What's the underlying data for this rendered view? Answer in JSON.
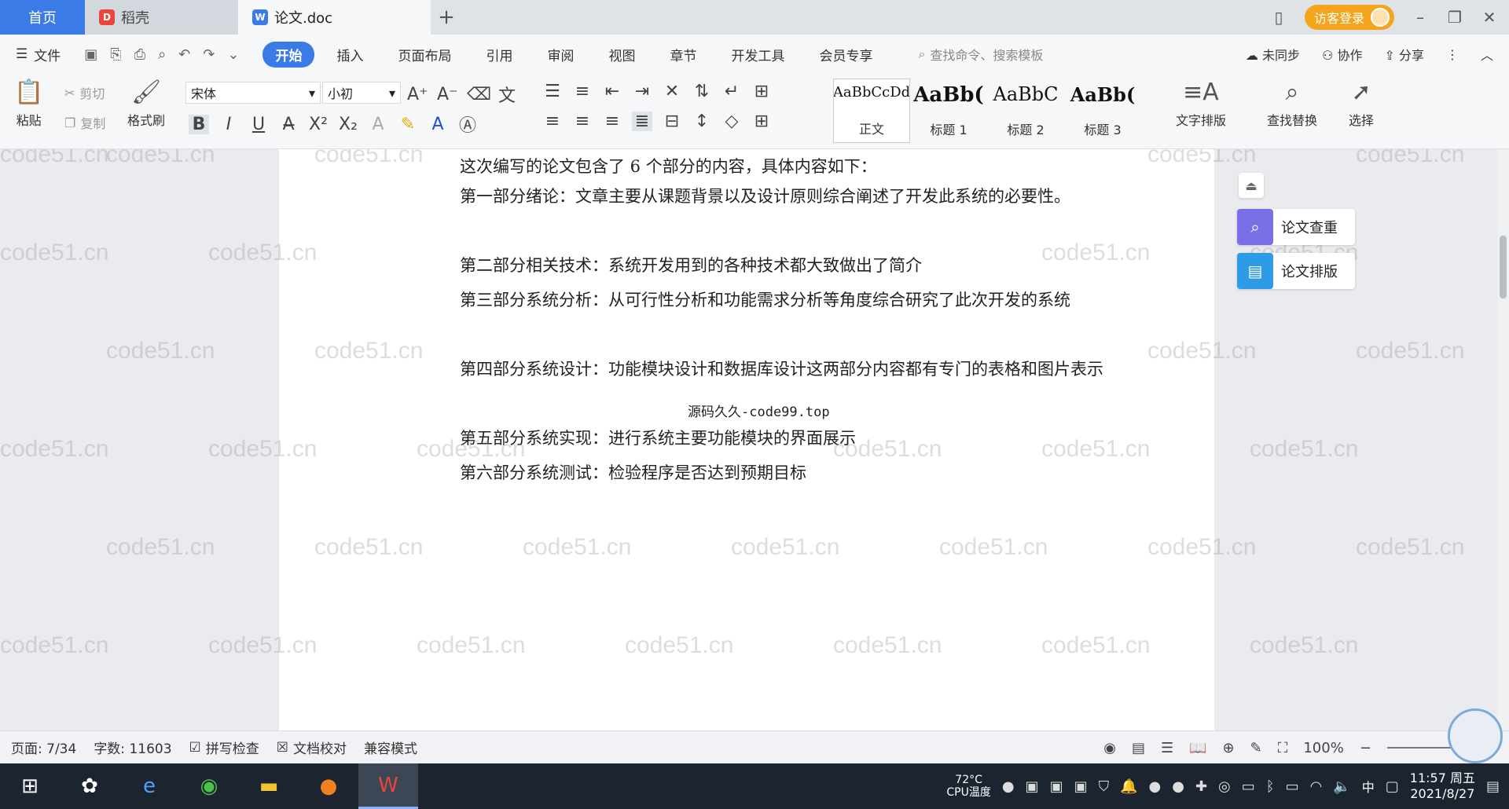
{
  "titlebar": {
    "tabs": [
      {
        "label": "首页",
        "icon": "home"
      },
      {
        "label": "稻壳",
        "icon": "docer-icon"
      },
      {
        "label": "论文.doc",
        "icon": "word-doc-icon"
      }
    ],
    "visitor_label": "访客登录"
  },
  "menubar": {
    "file_label": "文件",
    "tabs": [
      "开始",
      "插入",
      "页面布局",
      "引用",
      "审阅",
      "视图",
      "章节",
      "开发工具",
      "会员专享"
    ],
    "active_tab": "开始",
    "search_placeholder": "查找命令、搜索模板",
    "unsynced_label": "未同步",
    "collab_label": "协作",
    "share_label": "分享"
  },
  "ribbon": {
    "paste_label": "粘贴",
    "cut_label": "剪切",
    "copy_label": "复制",
    "format_painter_label": "格式刷",
    "font_name": "宋体",
    "font_size": "小初",
    "styles": [
      {
        "sample": "AaBbCcDd",
        "label": "正文"
      },
      {
        "sample": "AaBb(",
        "label": "标题 1"
      },
      {
        "sample": "AaBbC",
        "label": "标题 2"
      },
      {
        "sample": "AaBb(",
        "label": "标题 3"
      }
    ],
    "text_layout_label": "文字排版",
    "find_replace_label": "查找替换",
    "select_label": "选择"
  },
  "document": {
    "paragraphs": [
      "这次编写的论文包含了 6 个部分的内容，具体内容如下：",
      "第一部分绪论：文章主要从课题背景以及设计原则综合阐述了开发此系统的必要性。",
      "第二部分相关技术：系统开发用到的各种技术都大致做出了简介",
      "第三部分系统分析：从可行性分析和功能需求分析等角度综合研究了此次开发的系统",
      "第四部分系统设计：功能模块设计和数据库设计这两部分内容都有专门的表格和图片表示",
      "第五部分系统实现：进行系统主要功能模块的界面展示",
      "第六部分系统测试：检验程序是否达到预期目标"
    ],
    "overlay_text": "源码久久-code99.top",
    "watermark": "code51.cn"
  },
  "side_panel": {
    "check_label": "论文查重",
    "layout_label": "论文排版"
  },
  "statusbar": {
    "page": "页面: 7/34",
    "word_count": "字数: 11603",
    "spell_check": "拼写检查",
    "doc_proof": "文档校对",
    "compat_mode": "兼容模式",
    "zoom": "100%"
  },
  "taskbar": {
    "cpu_temp": "72°C",
    "cpu_label": "CPU温度",
    "ime": "中",
    "time": "11:57 周五",
    "date": "2021/8/27"
  },
  "colors": {
    "accent": "#3b7be8",
    "visitor": "#f4a51c",
    "taskbar": "#1c2430"
  }
}
